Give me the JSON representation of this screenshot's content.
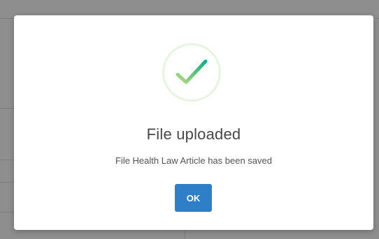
{
  "dialog": {
    "title": "File uploaded",
    "message": "File Health Law Article has been saved",
    "ok_label": "OK",
    "icon": "checkmark-icon"
  },
  "colors": {
    "button": "#2e7fc8",
    "check_start": "#a8d87c",
    "check_end": "#1db385",
    "ring": "#e6f4e1",
    "overlay": "#8e8e8e"
  }
}
